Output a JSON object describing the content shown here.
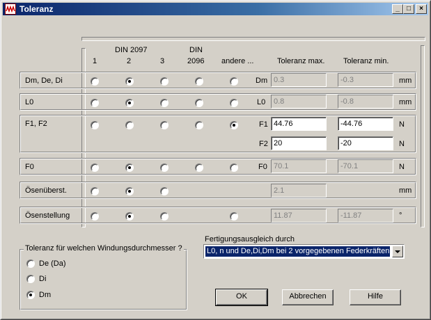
{
  "window": {
    "title": "Toleranz"
  },
  "titlebar_buttons": {
    "minimize": "_",
    "maximize": "□",
    "close": "×"
  },
  "header": {
    "col_din2097": "DIN 2097",
    "col_1": "1",
    "col_2": "2",
    "col_3": "3",
    "col_din": "DIN",
    "col_2096": "2096",
    "col_andere": "andere ...",
    "col_tol_max": "Toleranz max.",
    "col_tol_min": "Toleranz min."
  },
  "rows": [
    {
      "label": "Dm, De, Di",
      "selected": 2,
      "fields": [
        {
          "prefix": "Dm",
          "max": "0.3",
          "min": "-0.3",
          "unit": "mm",
          "enabled": false
        }
      ]
    },
    {
      "label": "L0",
      "selected": 2,
      "fields": [
        {
          "prefix": "L0",
          "max": "0.8",
          "min": "-0.8",
          "unit": "mm",
          "enabled": false
        }
      ]
    },
    {
      "label": "F1, F2",
      "selected": 5,
      "fields": [
        {
          "prefix": "F1",
          "max": "44.76",
          "min": "-44.76",
          "unit": "N",
          "enabled": true
        },
        {
          "prefix": "F2",
          "max": "20",
          "min": "-20",
          "unit": "N",
          "enabled": true
        }
      ]
    },
    {
      "label": "F0",
      "selected": 2,
      "fields": [
        {
          "prefix": "F0",
          "max": "70.1",
          "min": "-70.1",
          "unit": "N",
          "enabled": false
        }
      ]
    },
    {
      "label": "Ösenüberst.",
      "selected": 2,
      "fields": [
        {
          "prefix": "",
          "max": "2.1",
          "min": "",
          "unit": "mm",
          "enabled": false
        }
      ]
    },
    {
      "label": "Ösenstellung",
      "selected": 2,
      "fields": [
        {
          "prefix": "",
          "max": "11.87",
          "min": "-11.87",
          "unit": "°",
          "enabled": false
        }
      ]
    }
  ],
  "diameter_group": {
    "title": "Toleranz für welchen Windungsdurchmesser ?",
    "options": [
      "De (Da)",
      "Di",
      "Dm"
    ],
    "selected": "Dm"
  },
  "fertigung": {
    "label": "Fertigungsausgleich durch",
    "value": "L0, n und De,Di,Dm bei 2 vorgegebenen Federkräften"
  },
  "buttons": {
    "ok": "OK",
    "cancel": "Abbrechen",
    "help": "Hilfe"
  }
}
